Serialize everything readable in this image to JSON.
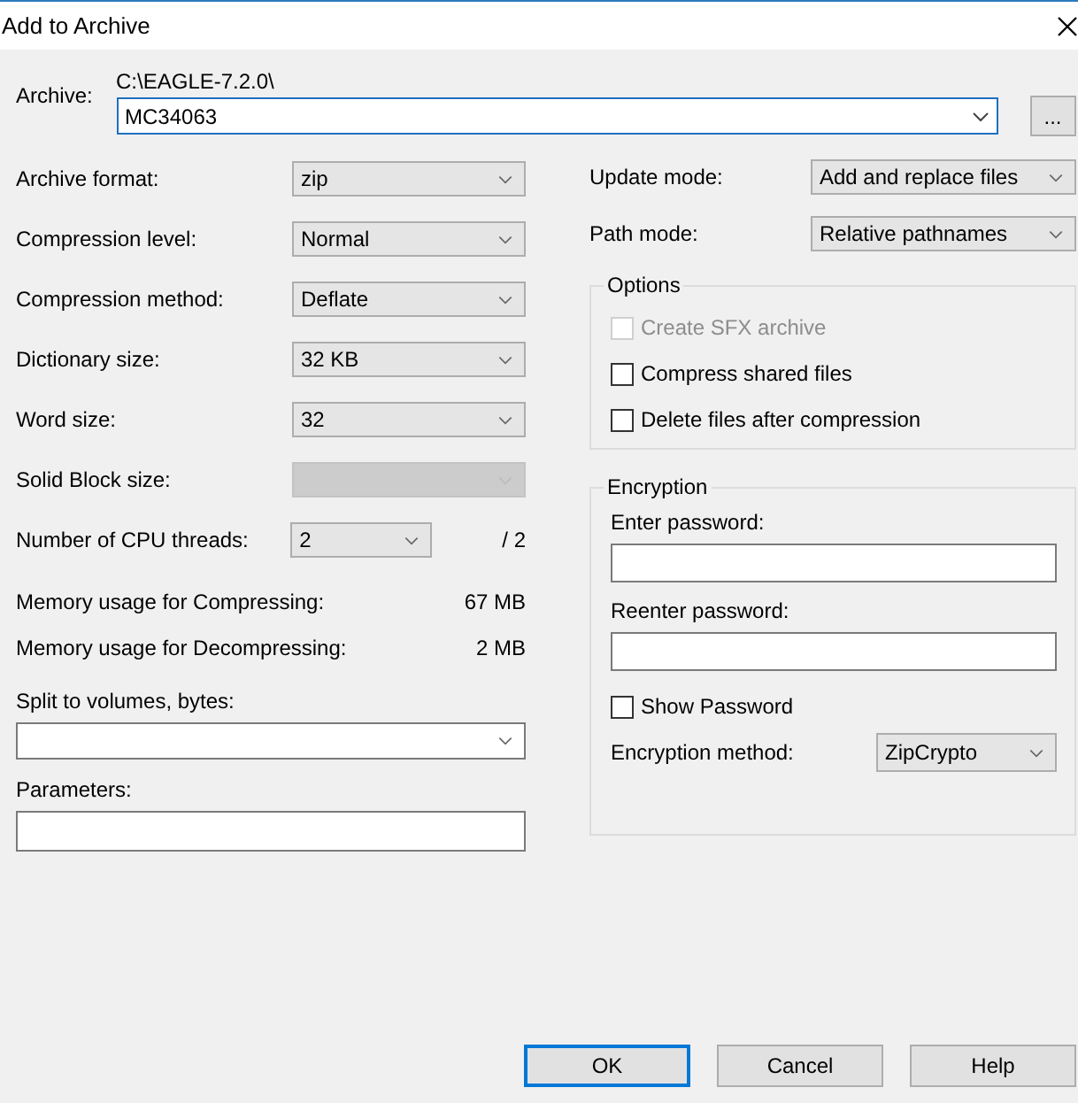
{
  "window": {
    "title": "Add to Archive"
  },
  "archive": {
    "label": "Archive:",
    "path": "C:\\EAGLE-7.2.0\\",
    "value": "MC34063",
    "browse": "..."
  },
  "left_fields": [
    {
      "kind": "combo",
      "label": "Archive format:",
      "value": "zip",
      "disabled": false
    },
    {
      "kind": "combo",
      "label": "Compression level:",
      "value": "Normal",
      "disabled": false
    },
    {
      "kind": "combo",
      "label": "Compression method:",
      "value": "Deflate",
      "disabled": false
    },
    {
      "kind": "combo",
      "label": "Dictionary size:",
      "value": "32 KB",
      "disabled": false
    },
    {
      "kind": "combo",
      "label": "Word size:",
      "value": "32",
      "disabled": false
    },
    {
      "kind": "combo",
      "label": "Solid Block size:",
      "disabled": true
    },
    {
      "kind": "short",
      "label": "Number of CPU threads:",
      "value": "2",
      "suffix": "/ 2",
      "disabled": false
    }
  ],
  "memory": [
    {
      "label": "Memory usage for Compressing:",
      "value": "67 MB"
    },
    {
      "label": "Memory usage for Decompressing:",
      "value": "2 MB"
    }
  ],
  "split": {
    "label": "Split to volumes, bytes:"
  },
  "parameters": {
    "label": "Parameters:"
  },
  "right_fields": [
    {
      "label": "Update mode:",
      "value": "Add and replace files"
    },
    {
      "label": "Path mode:",
      "value": "Relative pathnames"
    }
  ],
  "options": {
    "title": "Options",
    "items": [
      {
        "label": "Create SFX archive",
        "checked": false,
        "disabled": true
      },
      {
        "label": "Compress shared files",
        "checked": false,
        "disabled": false
      },
      {
        "label": "Delete files after compression",
        "checked": false,
        "disabled": false
      }
    ]
  },
  "encryption": {
    "title": "Encryption",
    "password_label": "Enter password:",
    "reenter_label": "Reenter password:",
    "show_password": {
      "label": "Show Password",
      "checked": false
    },
    "method_label": "Encryption method:",
    "method_value": "ZipCrypto"
  },
  "buttons": [
    {
      "label": "OK",
      "default": true
    },
    {
      "label": "Cancel",
      "default": false
    },
    {
      "label": "Help",
      "default": false
    }
  ]
}
